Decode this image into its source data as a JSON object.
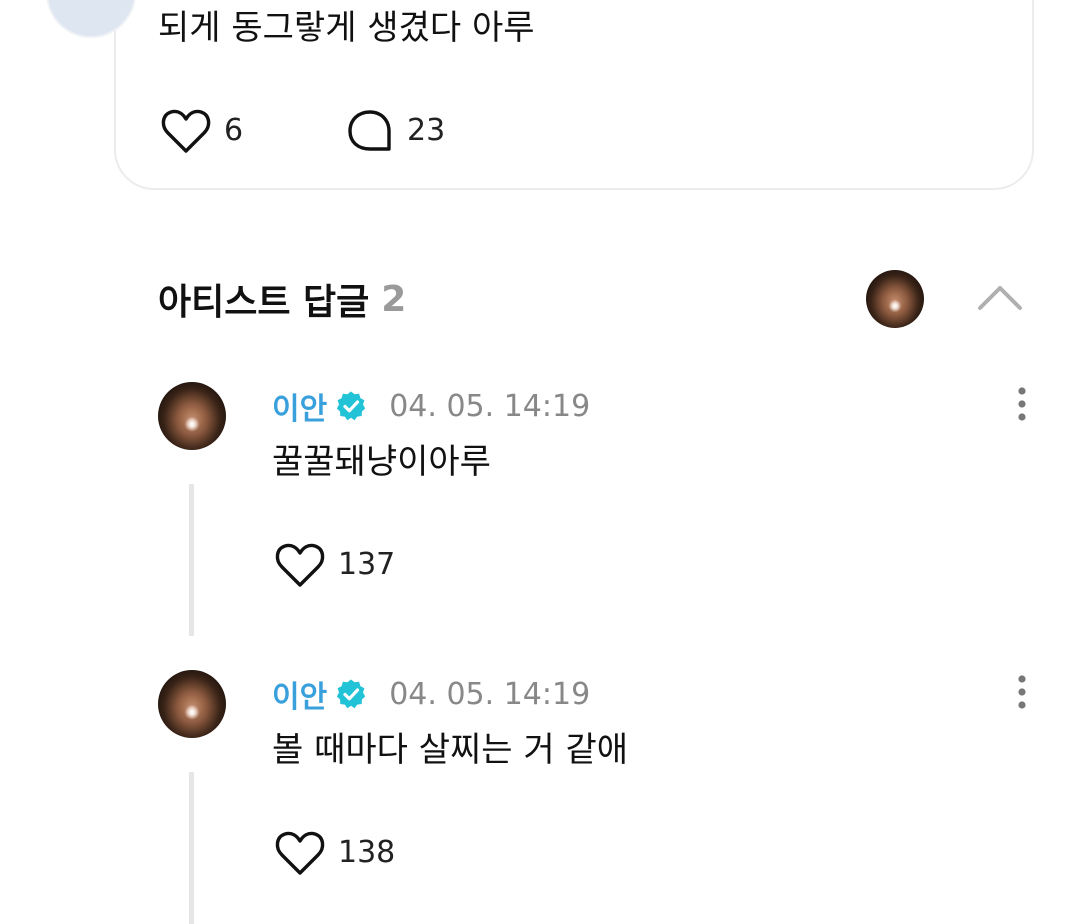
{
  "top_comment": {
    "text": "되게 동그랗게 생겼다 아루",
    "like_count": "6",
    "reply_count": "23",
    "icons": {
      "like": "heart-icon",
      "reply": "speech-bubble-icon"
    }
  },
  "artist_replies": {
    "title": "아티스트 답글",
    "count": "2",
    "icons": {
      "collapse": "chevron-up-icon",
      "more": "more-vertical-icon",
      "verified": "verified-badge-icon",
      "like": "heart-icon"
    },
    "colors": {
      "author": "#3aa0dc",
      "verified_badge": "#22c3d6",
      "count": "#9a9a9a"
    },
    "items": [
      {
        "author": "이안",
        "timestamp": "04. 05. 14:19",
        "text": "꿀꿀돼냥이아루",
        "like_count": "137"
      },
      {
        "author": "이안",
        "timestamp": "04. 05. 14:19",
        "text": "볼 때마다 살찌는 거 같애",
        "like_count": "138"
      }
    ]
  }
}
